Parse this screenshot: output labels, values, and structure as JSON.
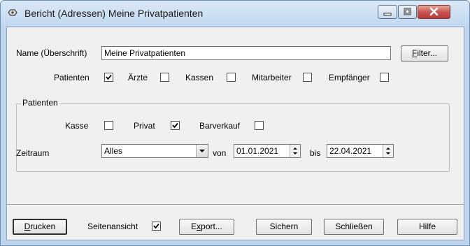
{
  "window": {
    "title": "Bericht (Adressen) Meine Privatpatienten",
    "icons": {
      "app": "report-icon",
      "minimize": "minimize-icon",
      "maximize": "maximize-icon",
      "close": "close-icon"
    }
  },
  "form": {
    "name_label": "Name (Überschrift)",
    "name_value": "Meine Privatpatienten",
    "filter_button": {
      "underline": "F",
      "rest": "ilter..."
    },
    "recipients": [
      {
        "label": "Patienten",
        "checked": true
      },
      {
        "label": "Ärzte",
        "checked": false
      },
      {
        "label": "Kassen",
        "checked": false
      },
      {
        "label": "Mitarbeiter",
        "checked": false
      },
      {
        "label": "Empfänger",
        "checked": false
      }
    ]
  },
  "patienten_group": {
    "title": "Patienten",
    "options": [
      {
        "label": "Kasse",
        "checked": false
      },
      {
        "label": "Privat",
        "checked": true
      },
      {
        "label": "Barverkauf",
        "checked": false
      }
    ],
    "zeitraum_label": "Zeitraum",
    "zeitraum_value": "Alles",
    "von_label": "von",
    "von_value": "01.01.2021",
    "bis_label": "bis",
    "bis_value": "22.04.2021"
  },
  "footer": {
    "drucken": {
      "underline": "D",
      "rest": "rucken"
    },
    "seitenansicht_label": "Seitenansicht",
    "seitenansicht_checked": true,
    "export": {
      "before": "E",
      "underline": "x",
      "rest": "port..."
    },
    "sichern": "Sichern",
    "schliessen": "Schließen",
    "hilfe": "Hilfe"
  }
}
